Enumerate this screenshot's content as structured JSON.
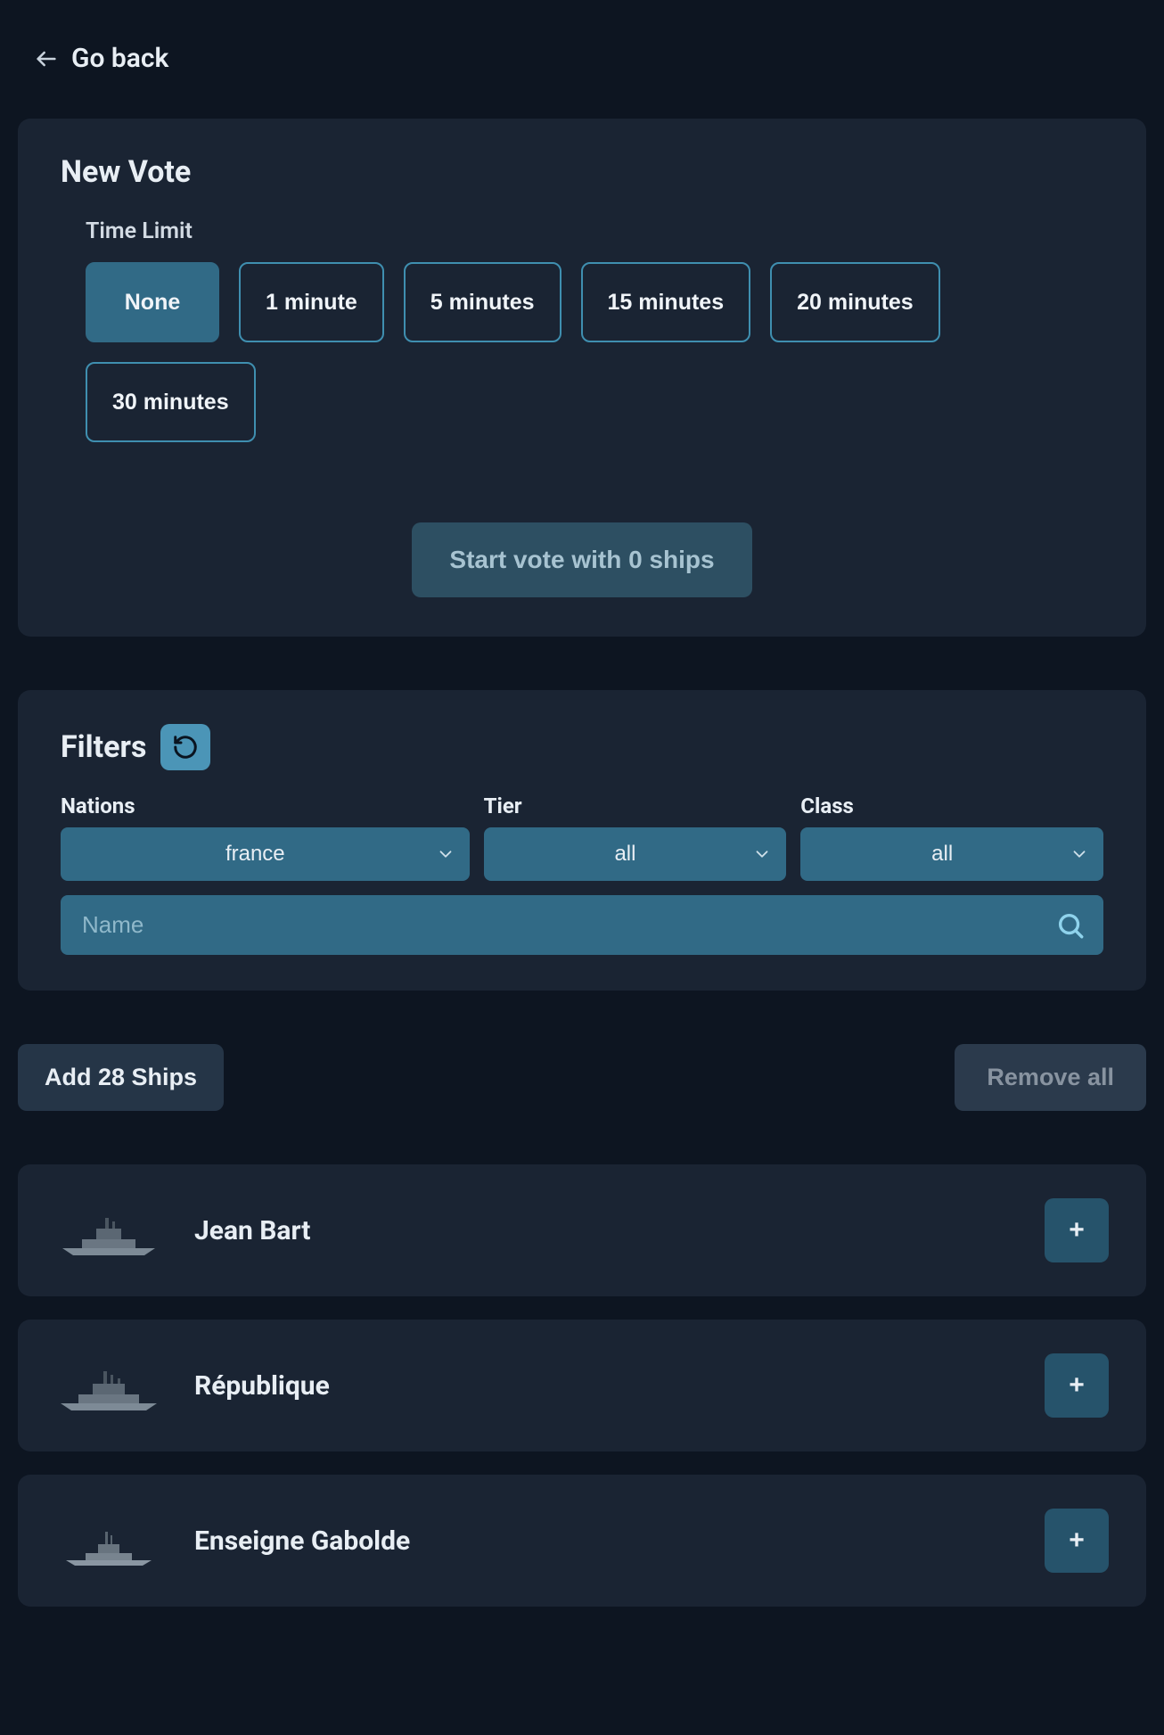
{
  "nav": {
    "go_back": "Go back"
  },
  "new_vote": {
    "title": "New Vote",
    "time_limit_label": "Time Limit",
    "options": [
      "None",
      "1 minute",
      "5 minutes",
      "15 minutes",
      "20 minutes",
      "30 minutes"
    ],
    "selected_index": 0,
    "start_button": "Start vote with 0 ships",
    "ship_count": 0
  },
  "filters": {
    "title": "Filters",
    "nations_label": "Nations",
    "nations_value": "france",
    "tier_label": "Tier",
    "tier_value": "all",
    "class_label": "Class",
    "class_value": "all",
    "search_placeholder": "Name",
    "search_value": ""
  },
  "bulk": {
    "add_label": "Add 28 Ships",
    "add_count": 28,
    "remove_label": "Remove all"
  },
  "ships": [
    {
      "name": "Jean Bart",
      "add": "+"
    },
    {
      "name": "République",
      "add": "+"
    },
    {
      "name": "Enseigne Gabolde",
      "add": "+"
    }
  ],
  "colors": {
    "bg": "#0d1521",
    "panel": "#1a2433",
    "accent": "#316a86",
    "accent_light": "#4b95b7"
  }
}
